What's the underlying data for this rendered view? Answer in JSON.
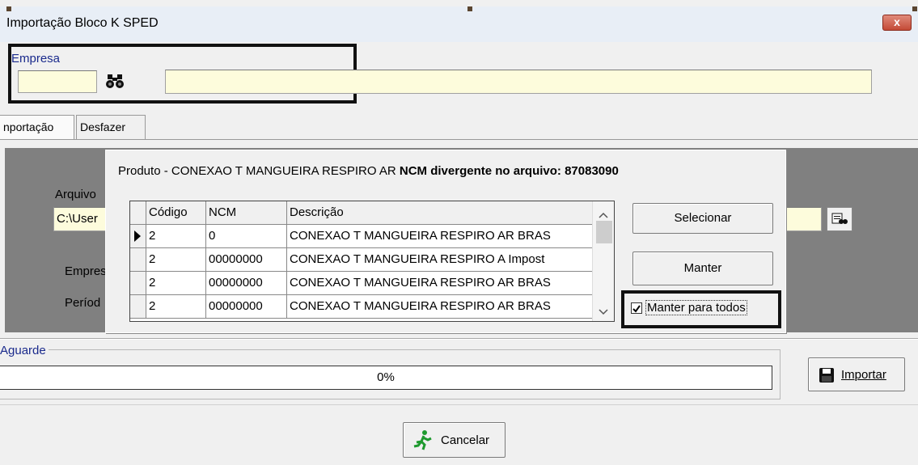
{
  "window": {
    "title": "Importação Bloco K SPED",
    "close_glyph": "x"
  },
  "empresa": {
    "label": "Empresa",
    "code_value": "",
    "name_value": ""
  },
  "tabs": [
    {
      "label": "nportação"
    },
    {
      "label": "Desfazer"
    }
  ],
  "panel": {
    "arquivo_label": "Arquivo",
    "arquivo_value": "C:\\User",
    "empresa_label": "Empres",
    "periodo_label": "Períod"
  },
  "dialog": {
    "message_prefix": "Produto - CONEXAO T MANGUEIRA RESPIRO AR ",
    "message_bold": "NCM divergente no arquivo: 87083090",
    "columns": [
      "Código",
      "NCM",
      "Descrição"
    ],
    "rows": [
      {
        "codigo": "2",
        "ncm": "0",
        "descricao": "CONEXAO T MANGUEIRA RESPIRO AR BRAS",
        "current": true
      },
      {
        "codigo": "2",
        "ncm": "00000000",
        "descricao": "CONEXAO T MANGUEIRA RESPIRO A Impost",
        "current": false
      },
      {
        "codigo": "2",
        "ncm": "00000000",
        "descricao": "CONEXAO T MANGUEIRA RESPIRO AR BRAS",
        "current": false
      },
      {
        "codigo": "2",
        "ncm": "00000000",
        "descricao": "CONEXAO T MANGUEIRA RESPIRO AR BRAS",
        "current": false
      }
    ],
    "select_button": "Selecionar",
    "keep_button": "Manter",
    "keep_all_checkbox": {
      "label": "Manter para todos",
      "checked": true
    }
  },
  "progress": {
    "group_label": "Aguarde",
    "value_text": "0%"
  },
  "buttons": {
    "import": "Importar",
    "cancel": "Cancelar"
  },
  "colors": {
    "input_bg": "#fdfcdc",
    "label_blue": "#1a2a8c",
    "panel_gray": "#808080"
  }
}
